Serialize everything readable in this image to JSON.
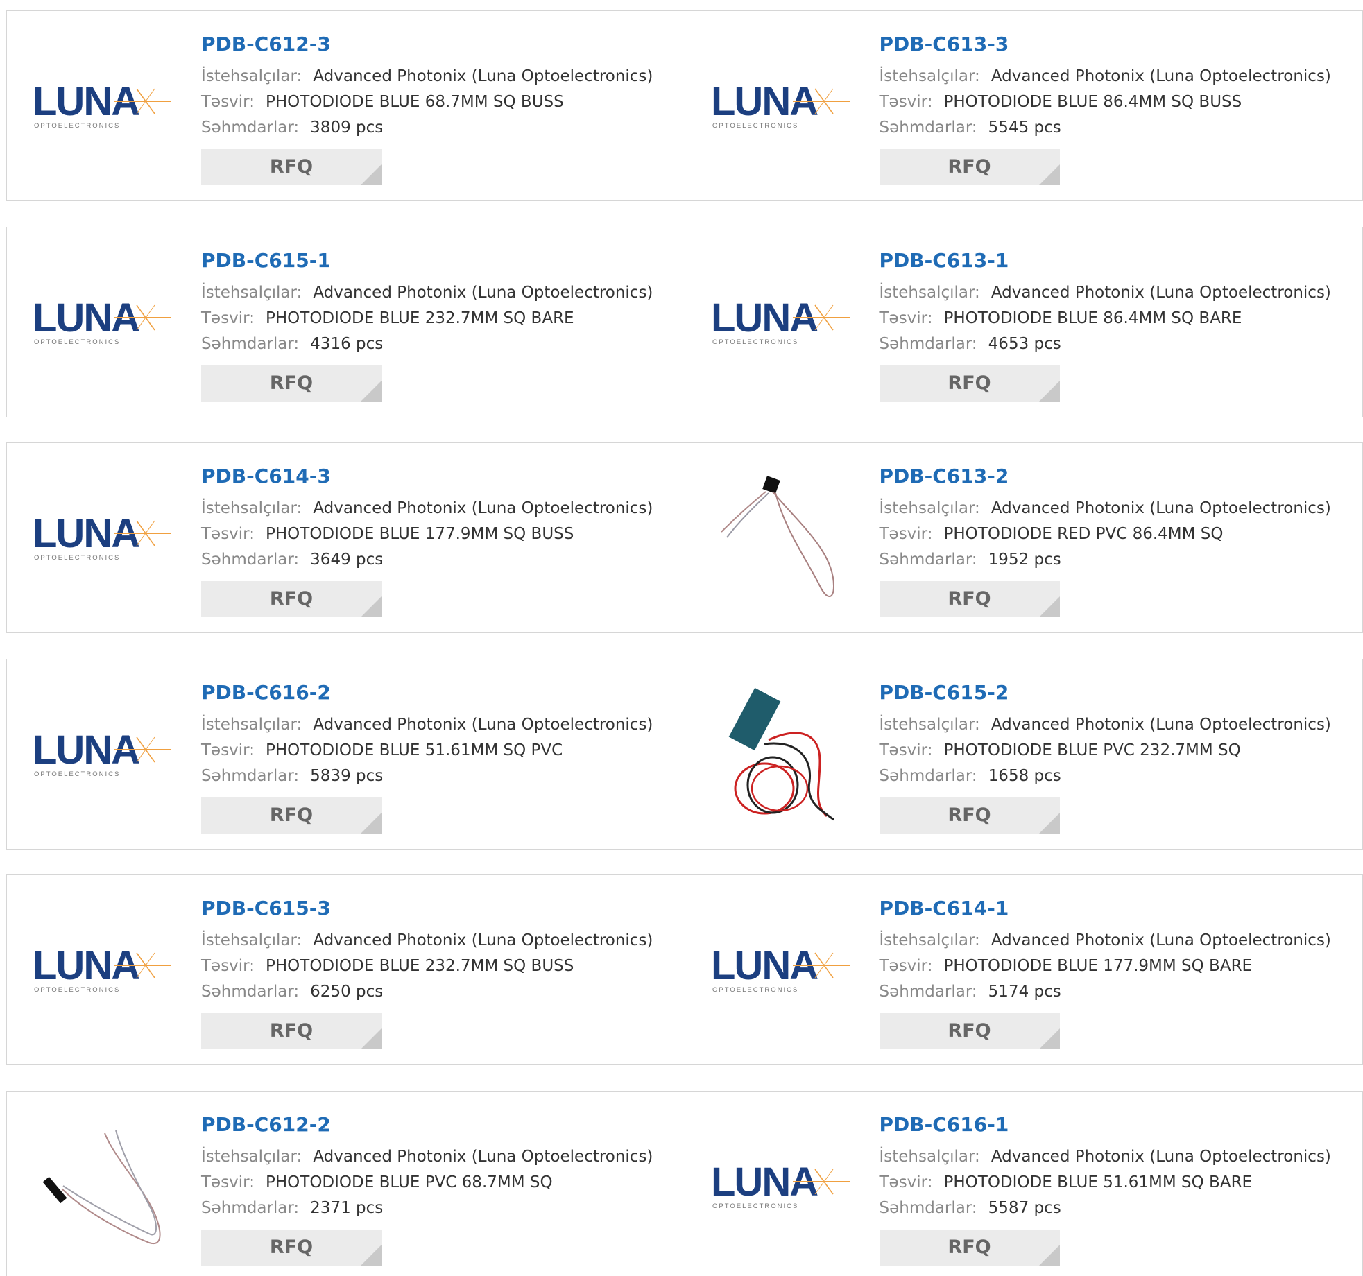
{
  "labels": {
    "manufacturer": "İstehsalçılar:",
    "description": "Təsvir:",
    "stock": "Səhmdarlar:",
    "rfq": "RFQ"
  },
  "logo": {
    "word": "LUNA",
    "sub": "OPTOELECTRONICS"
  },
  "colors": {
    "link": "#1f6bb5",
    "logo_blue": "#1c3f80",
    "logo_orange": "#f0a040",
    "border": "#d6d6d6",
    "button_bg": "#ebebeb"
  },
  "products": [
    {
      "pn": "PDB-C612-3",
      "manufacturer": "Advanced Photonix (Luna Optoelectronics)",
      "description": "PHOTODIODE BLUE 68.7MM SQ BUSS",
      "stock": "3809 pcs",
      "image": "luna-logo"
    },
    {
      "pn": "PDB-C613-3",
      "manufacturer": "Advanced Photonix (Luna Optoelectronics)",
      "description": "PHOTODIODE BLUE 86.4MM SQ BUSS",
      "stock": "5545 pcs",
      "image": "luna-logo"
    },
    {
      "pn": "PDB-C615-1",
      "manufacturer": "Advanced Photonix (Luna Optoelectronics)",
      "description": "PHOTODIODE BLUE 232.7MM SQ BARE",
      "stock": "4316 pcs",
      "image": "luna-logo"
    },
    {
      "pn": "PDB-C613-1",
      "manufacturer": "Advanced Photonix (Luna Optoelectronics)",
      "description": "PHOTODIODE BLUE 86.4MM SQ BARE",
      "stock": "4653 pcs",
      "image": "luna-logo"
    },
    {
      "pn": "PDB-C614-3",
      "manufacturer": "Advanced Photonix (Luna Optoelectronics)",
      "description": "PHOTODIODE BLUE 177.9MM SQ BUSS",
      "stock": "3649 pcs",
      "image": "luna-logo"
    },
    {
      "pn": "PDB-C613-2",
      "manufacturer": "Advanced Photonix (Luna Optoelectronics)",
      "description": "PHOTODIODE RED PVC 86.4MM SQ",
      "stock": "1952 pcs",
      "image": "photodiode-square-leads"
    },
    {
      "pn": "PDB-C616-2",
      "manufacturer": "Advanced Photonix (Luna Optoelectronics)",
      "description": "PHOTODIODE BLUE 51.61MM SQ PVC",
      "stock": "5839 pcs",
      "image": "luna-logo"
    },
    {
      "pn": "PDB-C615-2",
      "manufacturer": "Advanced Photonix (Luna Optoelectronics)",
      "description": "PHOTODIODE BLUE PVC 232.7MM SQ",
      "stock": "1658 pcs",
      "image": "photodiode-strip-coiled-leads"
    },
    {
      "pn": "PDB-C615-3",
      "manufacturer": "Advanced Photonix (Luna Optoelectronics)",
      "description": "PHOTODIODE BLUE 232.7MM SQ BUSS",
      "stock": "6250 pcs",
      "image": "luna-logo"
    },
    {
      "pn": "PDB-C614-1",
      "manufacturer": "Advanced Photonix (Luna Optoelectronics)",
      "description": "PHOTODIODE BLUE 177.9MM SQ BARE",
      "stock": "5174 pcs",
      "image": "luna-logo"
    },
    {
      "pn": "PDB-C612-2",
      "manufacturer": "Advanced Photonix (Luna Optoelectronics)",
      "description": "PHOTODIODE BLUE PVC 68.7MM SQ",
      "stock": "2371 pcs",
      "image": "photodiode-small-leads"
    },
    {
      "pn": "PDB-C616-1",
      "manufacturer": "Advanced Photonix (Luna Optoelectronics)",
      "description": "PHOTODIODE BLUE 51.61MM SQ BARE",
      "stock": "5587 pcs",
      "image": "luna-logo"
    }
  ]
}
